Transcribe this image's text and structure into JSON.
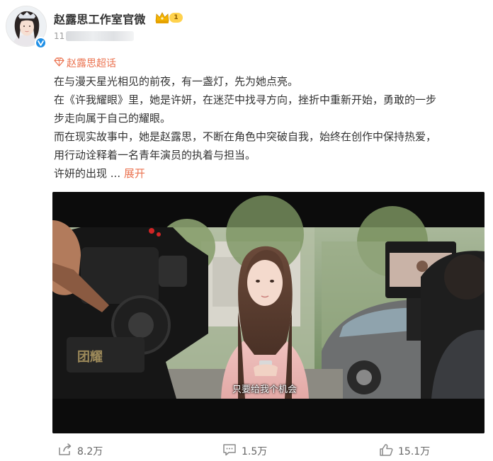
{
  "header": {
    "user_name": "赵露思工作室官微",
    "vip_level": "1",
    "time_prefix": "11"
  },
  "topic": {
    "label": "赵露思超话"
  },
  "post": {
    "lines": [
      "在与漫天星光相见的前夜，有一盏灯，先为她点亮。",
      "在《许我耀眼》里，她是许妍，在迷茫中找寻方向，挫折中重新开始，勇敢的一步",
      "步走向属于自己的耀眼。",
      "而在现实故事中，她是赵露思，不断在角色中突破自我，始终在创作中保持热爱，",
      "用行动诠释着一名青年演员的执着与担当。"
    ],
    "truncated_text": "许妍的出现",
    "ellipsis": " ...",
    "expand_label": "展开"
  },
  "video": {
    "subtitle": "只要给我个机会",
    "clapper_text": "团耀"
  },
  "actions": {
    "repost_count": "8.2万",
    "comment_count": "1.5万",
    "like_count": "15.1万"
  },
  "colors": {
    "accent": "#eb7350",
    "verified": "#1f8fe6",
    "text": "#333333",
    "muted": "#999999"
  },
  "icons": {
    "verified": "verified-icon",
    "vip": "crown-icon",
    "topic": "diamond-icon",
    "repost": "repost-icon",
    "comment": "comment-icon",
    "like": "like-icon"
  }
}
